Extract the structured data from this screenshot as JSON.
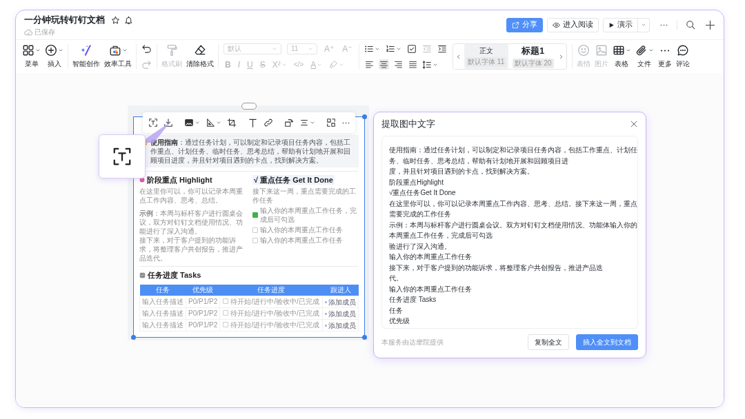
{
  "document": {
    "title": "一分钟玩转钉钉文档",
    "saved_status": "已保存"
  },
  "header_actions": [
    {
      "label": "分享",
      "kind": "primary"
    },
    {
      "label": "进入阅读",
      "kind": "read"
    },
    {
      "label": "演示",
      "kind": "present"
    }
  ],
  "toolbar": {
    "left_tools": [
      {
        "label": "菜单",
        "disabled": false
      },
      {
        "label": "插入",
        "disabled": false
      },
      {
        "label": "智能创作",
        "disabled": false
      },
      {
        "label": "效率工具",
        "disabled": false
      }
    ],
    "history": [
      {
        "disabled": false
      },
      {
        "disabled": true
      }
    ],
    "format_tools": [
      {
        "label": "格式刷",
        "disabled": true
      },
      {
        "label": "清除格式",
        "disabled": false
      }
    ],
    "font_family": "默认",
    "font_size": "11",
    "font_grow": "A⁺",
    "font_shrink": "A⁻",
    "text_formats": [
      "B",
      "I",
      "U",
      "S",
      "X²",
      "</>",
      "A"
    ],
    "alignments": [
      {
        "selected": false
      },
      {
        "selected": true
      },
      {
        "selected": false
      },
      {
        "selected": false
      }
    ],
    "styles": [
      {
        "name": "正文",
        "font": "默认字体 11",
        "selected": true
      },
      {
        "name": "标题1",
        "font": "默认字体 20",
        "selected": false
      }
    ],
    "insert_tools": [
      {
        "label": "表情",
        "disabled": true
      },
      {
        "label": "图片",
        "disabled": true
      },
      {
        "label": "表格",
        "disabled": false
      },
      {
        "label": "文件",
        "disabled": false
      },
      {
        "label": "更多",
        "disabled": false
      },
      {
        "label": "评论",
        "disabled": false
      }
    ]
  },
  "image": {
    "guide": "**使用指南**：通过任务计划，可以制定和记录项目任务内容，包括工作重点、计划任务、临时任务、思考总结，帮助有计划地开展和回顾项目进度，并且针对项目遇到的卡点，找到解决方案。",
    "highlight": {
      "title": "阶段重点 Highlight",
      "hint": "在这里你可以，你可以记录本周重点工作内容、思考、总结。",
      "example": "**示例**：本周与标杆客户进行圆桌会议，双方对钉钉文档使用情况、功能进行了深入沟通。",
      "next": "接下来，对于客户提到的功能诉求，将整理客户共创报告，推进产品迭代。"
    },
    "done": {
      "title": "√ 重点任务 Get It Done",
      "hint": "接下来这一周，重点需要完成的工作任务",
      "tasks": [
        {
          "text": "输入你的本周重点工作任务，完成后可勾选",
          "checked": true
        },
        {
          "text": "输入你的本周重点工作任务",
          "checked": false
        },
        {
          "text": "输入你的本周重点工作任务",
          "checked": false
        }
      ]
    },
    "tasks": {
      "title": "任务进度 Tasks",
      "columns": [
        "任务",
        "优先级",
        "任务进度",
        "跟进人"
      ],
      "rows": [
        {
          "task": "输入任务描述",
          "priority": "P0/P1/P2",
          "status": "待开始/进行中/验收中/已完成",
          "done": false,
          "assignee": "添加成员"
        },
        {
          "task": "输入任务描述",
          "priority": "P0/P1/P2",
          "status": "待开始/进行中/验收中/已完成",
          "done": false,
          "assignee": "添加成员"
        },
        {
          "task": "输入任务描述",
          "priority": "P0/P1/P2",
          "status": "待开始/进行中/验收中/已完成",
          "done": false,
          "assignee": "添加成员"
        }
      ]
    }
  },
  "ocr_panel": {
    "title": "提取图中文字",
    "lines": [
      "使用指南：通过任务计划，可以制定和记录项目任务内容，包括工作重点、计划任务、临时任务、思考总结，帮助有计划地开展和回顾项目进",
      "度，并且针对项目遇到的卡点，找到解决方案。",
      "阶段重点Highlight",
      "√重点任务Get It Done",
      "在这里你可以，你可以记录本周重点工作内容、思考、总结。接下来这一周，重点需要完成的工作任务",
      "示例：本周与标杆客户进行圆桌会议。双方对钉钉文档使用情况、功能体输入你的本周重点工作任务，完成后可勾选",
      "验进行了深入沟通。",
      "输入你的本周重点工作任务",
      "接下来，对于客户提到的功能诉求，将整理客户共创报告，推进产品迭",
      "代。",
      "输入你的本周重点工作任务",
      "任务进度 Tasks",
      "任务",
      "优先级"
    ],
    "footnote": "本服务由达摩院提供",
    "buttons": [
      {
        "label": "复制全文",
        "kind": "secondary"
      },
      {
        "label": "插入全文到文档",
        "kind": "primary"
      }
    ]
  }
}
